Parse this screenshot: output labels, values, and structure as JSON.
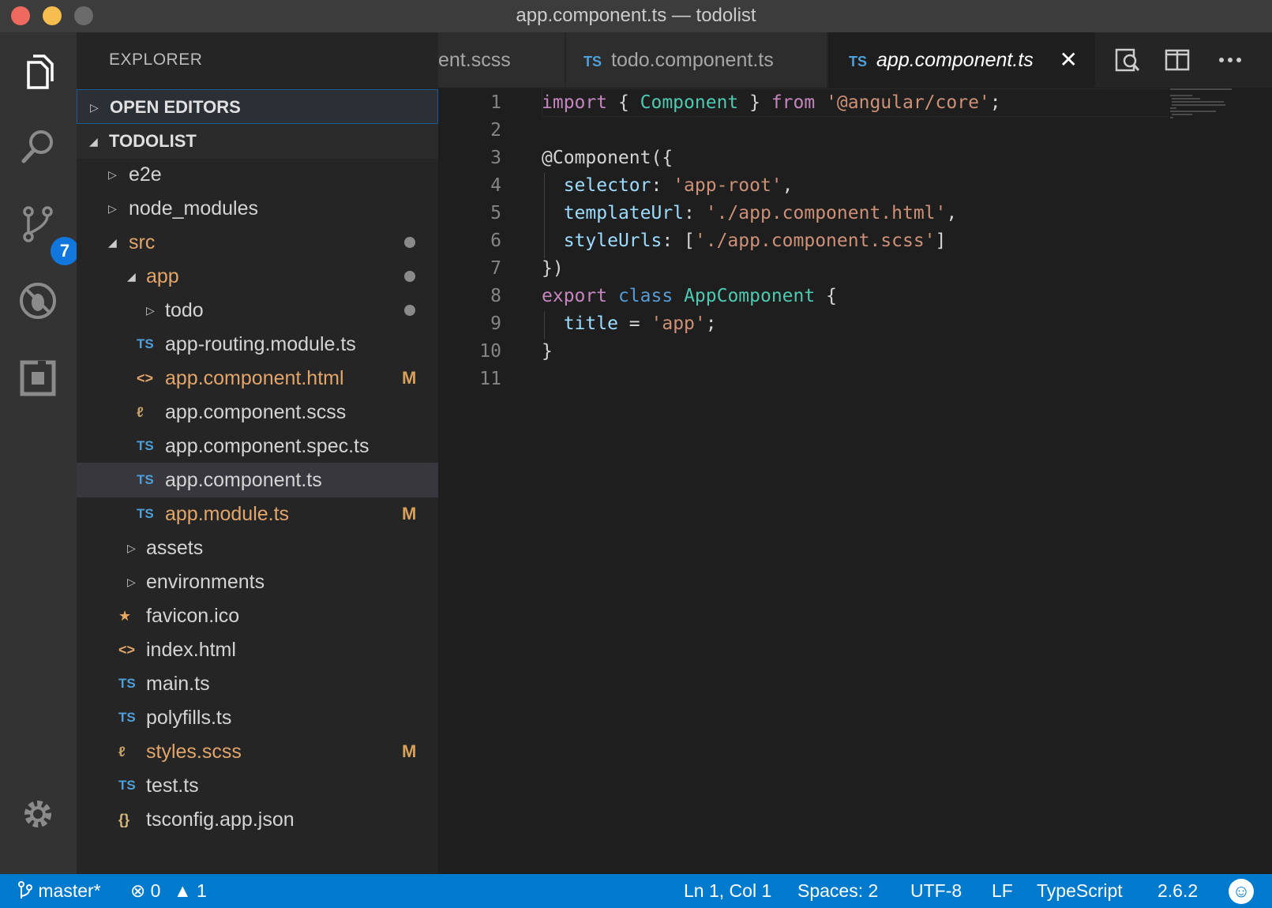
{
  "window": {
    "title": "app.component.ts — todolist"
  },
  "activity": {
    "scm_badge": "7"
  },
  "sidebar": {
    "header": "EXPLORER",
    "open_editors": "OPEN EDITORS",
    "project": "TODOLIST",
    "tree": [
      {
        "name": "e2e",
        "icon": "",
        "kind": "folder",
        "expanded": false
      },
      {
        "name": "node_modules",
        "icon": "",
        "kind": "folder",
        "expanded": false
      },
      {
        "name": "src",
        "icon": "",
        "kind": "folder",
        "expanded": true
      },
      {
        "name": "app",
        "icon": "",
        "kind": "folder",
        "expanded": true
      },
      {
        "name": "todo",
        "icon": "",
        "kind": "folder",
        "expanded": false
      },
      {
        "name": "app-routing.module.ts",
        "icon": "TS",
        "kind": "ts"
      },
      {
        "name": "app.component.html",
        "icon": "<>",
        "kind": "html",
        "status": "M"
      },
      {
        "name": "app.component.scss",
        "icon": "",
        "kind": "scss"
      },
      {
        "name": "app.component.spec.ts",
        "icon": "TS",
        "kind": "ts"
      },
      {
        "name": "app.component.ts",
        "icon": "TS",
        "kind": "ts"
      },
      {
        "name": "app.module.ts",
        "icon": "TS",
        "kind": "ts",
        "status": "M"
      },
      {
        "name": "assets",
        "icon": "",
        "kind": "folder",
        "expanded": false
      },
      {
        "name": "environments",
        "icon": "",
        "kind": "folder",
        "expanded": false
      },
      {
        "name": "favicon.ico",
        "icon": "★",
        "kind": "ico"
      },
      {
        "name": "index.html",
        "icon": "<>",
        "kind": "html"
      },
      {
        "name": "main.ts",
        "icon": "TS",
        "kind": "ts"
      },
      {
        "name": "polyfills.ts",
        "icon": "TS",
        "kind": "ts"
      },
      {
        "name": "styles.scss",
        "icon": "",
        "kind": "scss",
        "status": "M"
      },
      {
        "name": "test.ts",
        "icon": "TS",
        "kind": "ts"
      },
      {
        "name": "tsconfig.app.json",
        "icon": "{}",
        "kind": "json"
      }
    ]
  },
  "tabs": [
    {
      "label": "ent.scss",
      "tag": ""
    },
    {
      "label": "todo.component.ts",
      "tag": "TS"
    },
    {
      "label": "app.component.ts",
      "tag": "TS",
      "close": "✕"
    }
  ],
  "editor": {
    "lines": [
      {
        "n": "1",
        "t": [
          [
            "kw",
            "import"
          ],
          [
            "punc",
            " { "
          ],
          [
            "ty",
            "Component"
          ],
          [
            "punc",
            " } "
          ],
          [
            "kw",
            "from"
          ],
          [
            "punc",
            " "
          ],
          [
            "str",
            "'@angular/core'"
          ],
          [
            "punc",
            ";"
          ]
        ]
      },
      {
        "n": "2",
        "t": []
      },
      {
        "n": "3",
        "t": [
          [
            "plain",
            "@Component({"
          ]
        ]
      },
      {
        "n": "4",
        "t": [
          [
            "punc",
            "  "
          ],
          [
            "prop",
            "selector"
          ],
          [
            "punc",
            ": "
          ],
          [
            "str",
            "'app-root'"
          ],
          [
            "punc",
            ","
          ]
        ]
      },
      {
        "n": "5",
        "t": [
          [
            "punc",
            "  "
          ],
          [
            "prop",
            "templateUrl"
          ],
          [
            "punc",
            ": "
          ],
          [
            "str",
            "'./app.component.html'"
          ],
          [
            "punc",
            ","
          ]
        ]
      },
      {
        "n": "6",
        "t": [
          [
            "punc",
            "  "
          ],
          [
            "prop",
            "styleUrls"
          ],
          [
            "punc",
            ": ["
          ],
          [
            "str",
            "'./app.component.scss'"
          ],
          [
            "punc",
            "]"
          ]
        ]
      },
      {
        "n": "7",
        "t": [
          [
            "punc",
            "})"
          ]
        ]
      },
      {
        "n": "8",
        "t": [
          [
            "kw",
            "export"
          ],
          [
            "punc",
            " "
          ],
          [
            "kw2",
            "class"
          ],
          [
            "punc",
            " "
          ],
          [
            "ty",
            "AppComponent"
          ],
          [
            "punc",
            " {"
          ]
        ]
      },
      {
        "n": "9",
        "t": [
          [
            "punc",
            "  "
          ],
          [
            "prop",
            "title"
          ],
          [
            "punc",
            " = "
          ],
          [
            "str",
            "'app'"
          ],
          [
            "punc",
            ";"
          ]
        ]
      },
      {
        "n": "10",
        "t": [
          [
            "punc",
            "}"
          ]
        ]
      },
      {
        "n": "11",
        "t": []
      }
    ]
  },
  "status": {
    "branch": "master*",
    "errors": "0",
    "warnings": "1",
    "position": "Ln 1, Col 1",
    "spaces": "Spaces: 2",
    "encoding": "UTF-8",
    "eol": "LF",
    "language": "TypeScript",
    "version": "2.6.2"
  },
  "colors": {
    "accent": "#007acc",
    "modified": "#e2a56a",
    "badge": "#1177dd"
  }
}
